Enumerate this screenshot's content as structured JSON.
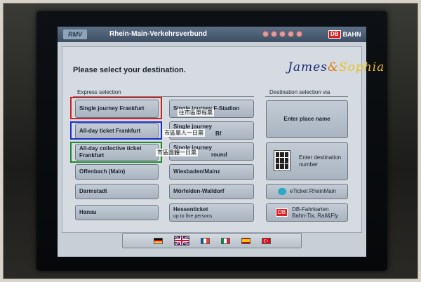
{
  "watermark": {
    "part1": "James",
    "amp": "&",
    "part2": "Sophia"
  },
  "topbar": {
    "logo": "RMV",
    "title": "Rhein-Main-Verkehrsverbund",
    "db_box": "DB",
    "db_text": "BAHN"
  },
  "page_title": "Please select your destination.",
  "express": {
    "label": "Express selection",
    "col1": [
      {
        "label": "Single journey Frankfurt"
      },
      {
        "label": "All-day ticket Frankfurt"
      },
      {
        "label": "All-day collective ticket Frankfurt"
      },
      {
        "label": "Offenbach (Main)"
      },
      {
        "label": "Darmstadt"
      },
      {
        "label": "Hanau"
      }
    ],
    "col2": [
      {
        "label": "Single journey F-Stadion"
      },
      {
        "label": "Single journey",
        "sub": "Bf"
      },
      {
        "label": "Single journey",
        "sub": "round"
      },
      {
        "label": "Wiesbaden/Mainz"
      },
      {
        "label": "Mörfelden-Walldorf"
      },
      {
        "label": "Hessenticket",
        "sub": "up to five persons"
      }
    ]
  },
  "destination": {
    "label": "Destination selection via",
    "enter_place": "Enter place name",
    "enter_number": "Enter destination number",
    "eticket": "eTicket RheinMain",
    "db_box": "DB",
    "db_fahrkarten": "DB-Fahrkarten",
    "db_fahrkarten_sub": "Bahn-Tix, Rail&Fly"
  },
  "notes": {
    "single": "往市區單程票",
    "allday": "市區單人一日票",
    "group": "市區團體一日票"
  },
  "languages": [
    "german-flag",
    "uk-flag",
    "french-flag",
    "italian-flag",
    "spanish-flag",
    "turkish-flag"
  ],
  "colors": {
    "highlight_red": "#d42020",
    "highlight_blue": "#1a2fd0",
    "highlight_green": "#1f8a2a",
    "db_red": "#e02020",
    "watermark_navy": "#1a2a7a",
    "watermark_orange": "#e07a10",
    "watermark_yellow": "#e8c020"
  }
}
